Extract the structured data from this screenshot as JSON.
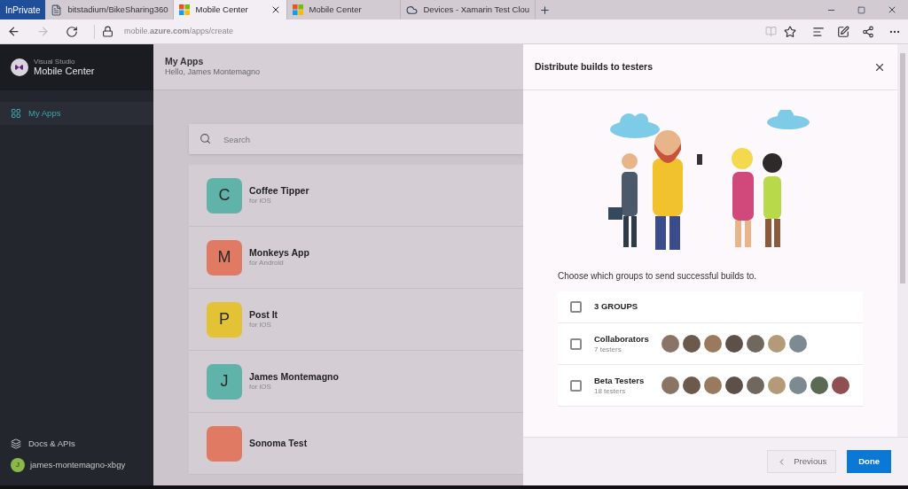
{
  "browser": {
    "private_badge": "InPrivate",
    "tabs": [
      {
        "label": "bitstadium/BikeSharing360",
        "kind": "page",
        "selected": false
      },
      {
        "label": "Mobile Center",
        "kind": "windows",
        "selected": true
      },
      {
        "label": "Mobile Center",
        "kind": "windows",
        "selected": false
      },
      {
        "label": "Devices - Xamarin Test Clou",
        "kind": "cloud",
        "selected": false
      }
    ],
    "forward_disabled": true,
    "url": "mobile.**azure.com**/apps/create"
  },
  "sidebar": {
    "product_line": "Visual Studio",
    "product": "Mobile Center",
    "items": [
      {
        "label": "My Apps",
        "selected": true
      }
    ],
    "docs_link": "Docs & APIs",
    "user": {
      "initial": "J",
      "name": "james-montemagno-xbgy"
    }
  },
  "main": {
    "title": "My Apps",
    "subtitle": "Hello, James Montemagno",
    "search": {
      "placeholder": "Search"
    },
    "apps": [
      {
        "letter": "C",
        "name": "Coffee Tipper",
        "platform": "for iOS",
        "color": "#5fb3a8"
      },
      {
        "letter": "M",
        "name": "Monkeys App",
        "platform": "for Android",
        "color": "#e07a63"
      },
      {
        "letter": "P",
        "name": "Post It",
        "platform": "for iOS",
        "color": "#e3c235"
      },
      {
        "letter": "J",
        "name": "James Montemagno",
        "platform": "for iOS",
        "color": "#5fb3a8"
      },
      {
        "name": "Sonoma Test",
        "color": "#e07a63"
      }
    ]
  },
  "panel": {
    "title": "Distribute builds to testers",
    "prompt": "Choose which groups to send successful builds to.",
    "groups": [
      {
        "kind": "all",
        "name": "3 GROUPS",
        "checked": false
      },
      {
        "kind": "group",
        "name": "Collaborators",
        "count": "7 testers",
        "checked": false,
        "avatars": [
          {
            "kind": "photo"
          },
          {
            "kind": "photo"
          },
          {
            "kind": "photo"
          },
          {
            "kind": "photo"
          },
          {
            "kind": "photo"
          },
          {
            "kind": "photo"
          },
          {
            "kind": "photo"
          }
        ]
      },
      {
        "kind": "group",
        "name": "Beta Testers",
        "count": "18 testers",
        "checked": false,
        "avatars": [
          {
            "kind": "photo"
          },
          {
            "kind": "photo"
          },
          {
            "kind": "photo"
          },
          {
            "kind": "photo"
          },
          {
            "kind": "photo"
          },
          {
            "kind": "photo"
          },
          {
            "kind": "photo"
          },
          {
            "kind": "photo"
          },
          {
            "kind": "photo"
          }
        ]
      }
    ],
    "previous": "Previous",
    "done": "Done"
  }
}
